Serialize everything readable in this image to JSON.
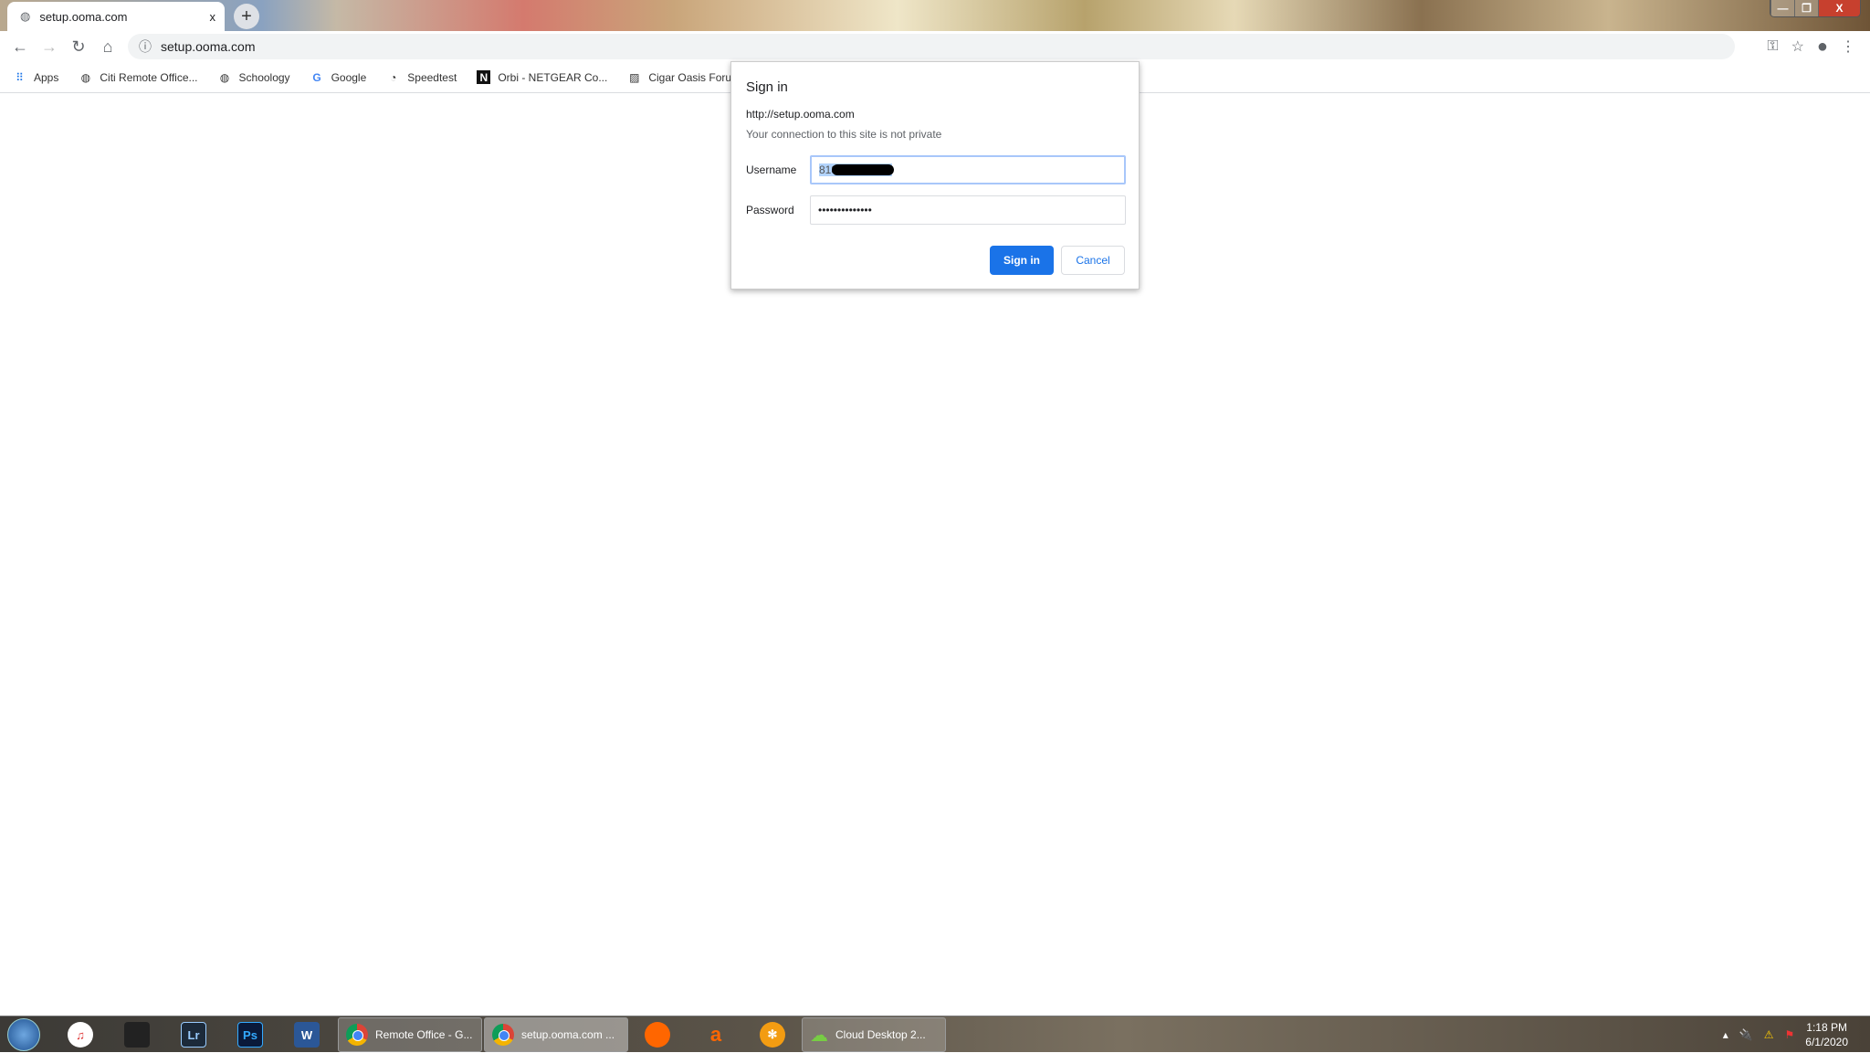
{
  "browser": {
    "tab": {
      "title": "setup.ooma.com",
      "close": "x",
      "new_tab": "+"
    },
    "window_controls": {
      "minimize": "—",
      "restore": "❐",
      "close": "X"
    },
    "address": "setup.ooma.com",
    "bookmarks": [
      {
        "label": "Apps",
        "icon": "apps-grid-icon"
      },
      {
        "label": "Citi Remote Office...",
        "icon": "globe-icon"
      },
      {
        "label": "Schoology",
        "icon": "globe-icon"
      },
      {
        "label": "Google",
        "icon": "google-icon"
      },
      {
        "label": "Speedtest",
        "icon": "speedtest-icon"
      },
      {
        "label": "Orbi - NETGEAR Co...",
        "icon": "netgear-icon"
      },
      {
        "label": "Cigar Oasis Forum",
        "icon": "cigar-icon"
      }
    ]
  },
  "dialog": {
    "title": "Sign in",
    "url": "http://setup.ooma.com",
    "note": "Your connection to this site is not private",
    "username_label": "Username",
    "username_value": "818",
    "password_label": "Password",
    "password_value": "••••••••••••••",
    "signin": "Sign in",
    "cancel": "Cancel",
    "accent": "#1a73e8"
  },
  "taskbar": {
    "pinned": [
      "iTunes",
      "Camera",
      "Lr",
      "Ps",
      "W"
    ],
    "tasks": [
      {
        "label": "Remote Office - G..."
      },
      {
        "label": "setup.ooma.com ..."
      },
      {
        "label": "Cloud Desktop 2..."
      }
    ],
    "extra": [
      "Firefox",
      "Avast",
      "Settings"
    ],
    "time": "1:18 PM",
    "date": "6/1/2020"
  }
}
